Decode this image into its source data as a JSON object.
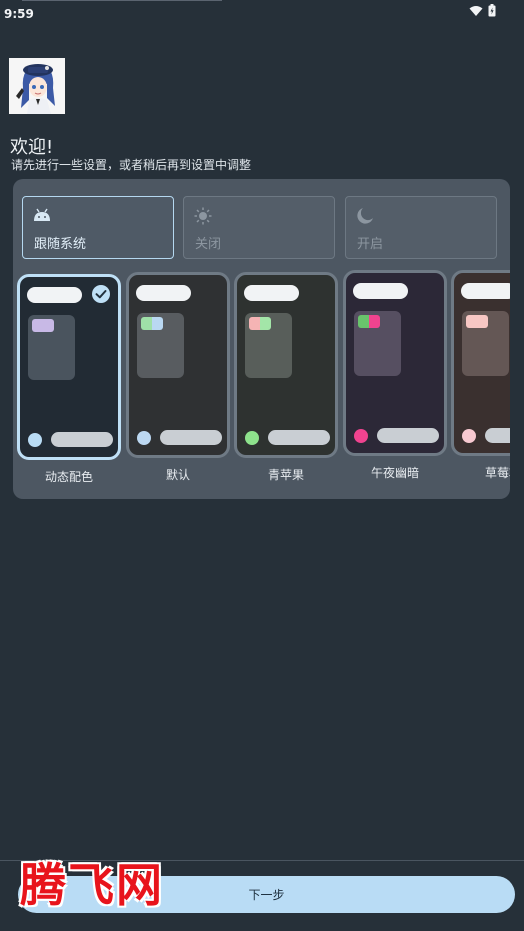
{
  "status_bar": {
    "time": "9:59"
  },
  "welcome": {
    "title": "欢迎!",
    "subtitle": "请先进行一些设置，或者稍后再到设置中调整"
  },
  "dark_mode": {
    "options": [
      {
        "label": "跟随系统",
        "icon": "android-icon",
        "selected": true
      },
      {
        "label": "关闭",
        "icon": "sun-icon",
        "selected": false
      },
      {
        "label": "开启",
        "icon": "moon-icon",
        "selected": false
      }
    ]
  },
  "themes": [
    {
      "name": "动态配色",
      "selected": true,
      "bg": "#222b34",
      "tile": "#4a545e",
      "chip": [
        "#c8b9e6",
        "#c8b9e6"
      ],
      "dot": "#b9dcf5"
    },
    {
      "name": "默认",
      "selected": false,
      "bg": "#2f3133",
      "tile": "#585c60",
      "chip": [
        "#9fe0a8",
        "#b9d8f2"
      ],
      "dot": "#bcd8f2"
    },
    {
      "name": "青苹果",
      "selected": false,
      "bg": "#2e3230",
      "tile": "#585e5a",
      "chip": [
        "#f5b4b4",
        "#a3e6a8"
      ],
      "dot": "#8ee28c"
    },
    {
      "name": "午夜幽暗",
      "selected": false,
      "bg": "#2c2837",
      "tile": "#564f61",
      "chip": [
        "#69c46c",
        "#f0438f"
      ],
      "dot": "#f0438f"
    },
    {
      "name": "草莓巧",
      "selected": false,
      "bg": "#3a302f",
      "tile": "#645755",
      "chip": [
        "#f7c7c4",
        "#f7c7c4"
      ],
      "dot": "#f7c9d1"
    }
  ],
  "footer": {
    "next_label": "下一步"
  },
  "watermark": {
    "text": "腾飞网"
  }
}
